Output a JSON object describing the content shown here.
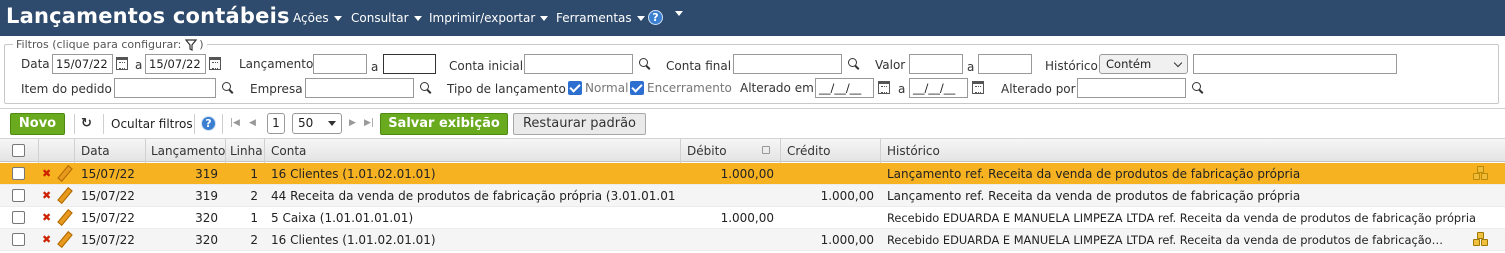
{
  "header": {
    "title": "Lançamentos contábeis",
    "menus": [
      "Ações",
      "Consultar",
      "Imprimir/exportar",
      "Ferramentas"
    ],
    "help_symbol": "?"
  },
  "filters": {
    "legend": "Filtros (clique para configurar:",
    "legend_close": ")",
    "data_label": "Data",
    "data_from": "15/07/22",
    "data_sep": "a",
    "data_to": "15/07/22",
    "lancamento_label": "Lançamento",
    "lancamento_from": "",
    "lancamento_sep": "a",
    "lancamento_to": "",
    "conta_inicial_label": "Conta inicial",
    "conta_inicial_value": "",
    "conta_final_label": "Conta final",
    "conta_final_value": "",
    "valor_label": "Valor",
    "valor_from": "",
    "valor_sep": "a",
    "valor_to": "",
    "historico_label": "Histórico",
    "historico_mode": "Contém",
    "historico_value": "",
    "item_pedido_label": "Item do pedido",
    "item_pedido_value": "",
    "empresa_label": "Empresa",
    "empresa_value": "",
    "tipo_label": "Tipo de lançamento",
    "tipo_normal": "Normal",
    "tipo_encerramento": "Encerramento",
    "alterado_em_label": "Alterado em",
    "alterado_em_from": "__/__/__",
    "alterado_em_sep": "a",
    "alterado_em_to": "__/__/__",
    "alterado_por_label": "Alterado por",
    "alterado_por_value": ""
  },
  "toolbar": {
    "new_label": "Novo",
    "hide_filters_label": "Ocultar filtros",
    "help_symbol": "?",
    "page_number": "1",
    "page_size": "50",
    "save_view_label": "Salvar exibição",
    "restore_default_label": "Restaurar padrão"
  },
  "grid": {
    "columns": {
      "data": "Data",
      "lancamento": "Lançamento",
      "linha": "Linha",
      "conta": "Conta",
      "debito": "Débito",
      "credito": "Crédito",
      "historico": "Histórico"
    },
    "rows": [
      {
        "data": "15/07/22",
        "lancamento": "319",
        "linha": "1",
        "conta": "16 Clientes (1.01.02.01.01)",
        "debito": "1.000,00",
        "credito": "",
        "historico": "Lançamento ref. Receita da venda de produtos de fabricação própria"
      },
      {
        "data": "15/07/22",
        "lancamento": "319",
        "linha": "2",
        "conta": "44 Receita da venda de produtos de fabricação própria (3.01.01.01)",
        "debito": "",
        "credito": "1.000,00",
        "historico": "Lançamento ref. Receita da venda de produtos de fabricação própria"
      },
      {
        "data": "15/07/22",
        "lancamento": "320",
        "linha": "1",
        "conta": "5 Caixa (1.01.01.01.01)",
        "debito": "1.000,00",
        "credito": "",
        "historico": "Recebido EDUARDA E MANUELA LIMPEZA LTDA ref. Receita da venda de produtos de fabricação própria"
      },
      {
        "data": "15/07/22",
        "lancamento": "320",
        "linha": "2",
        "conta": "16 Clientes (1.01.02.01.01)",
        "debito": "",
        "credito": "1.000,00",
        "historico": "Recebido EDUARDA E MANUELA LIMPEZA LTDA ref. Receita da venda de produtos de fabricação…"
      }
    ]
  },
  "colors": {
    "header_bg": "#2e4a6c",
    "selected_row": "#f7b221",
    "green_button": "#6aaa1e",
    "help_blue": "#3a7fd0"
  }
}
